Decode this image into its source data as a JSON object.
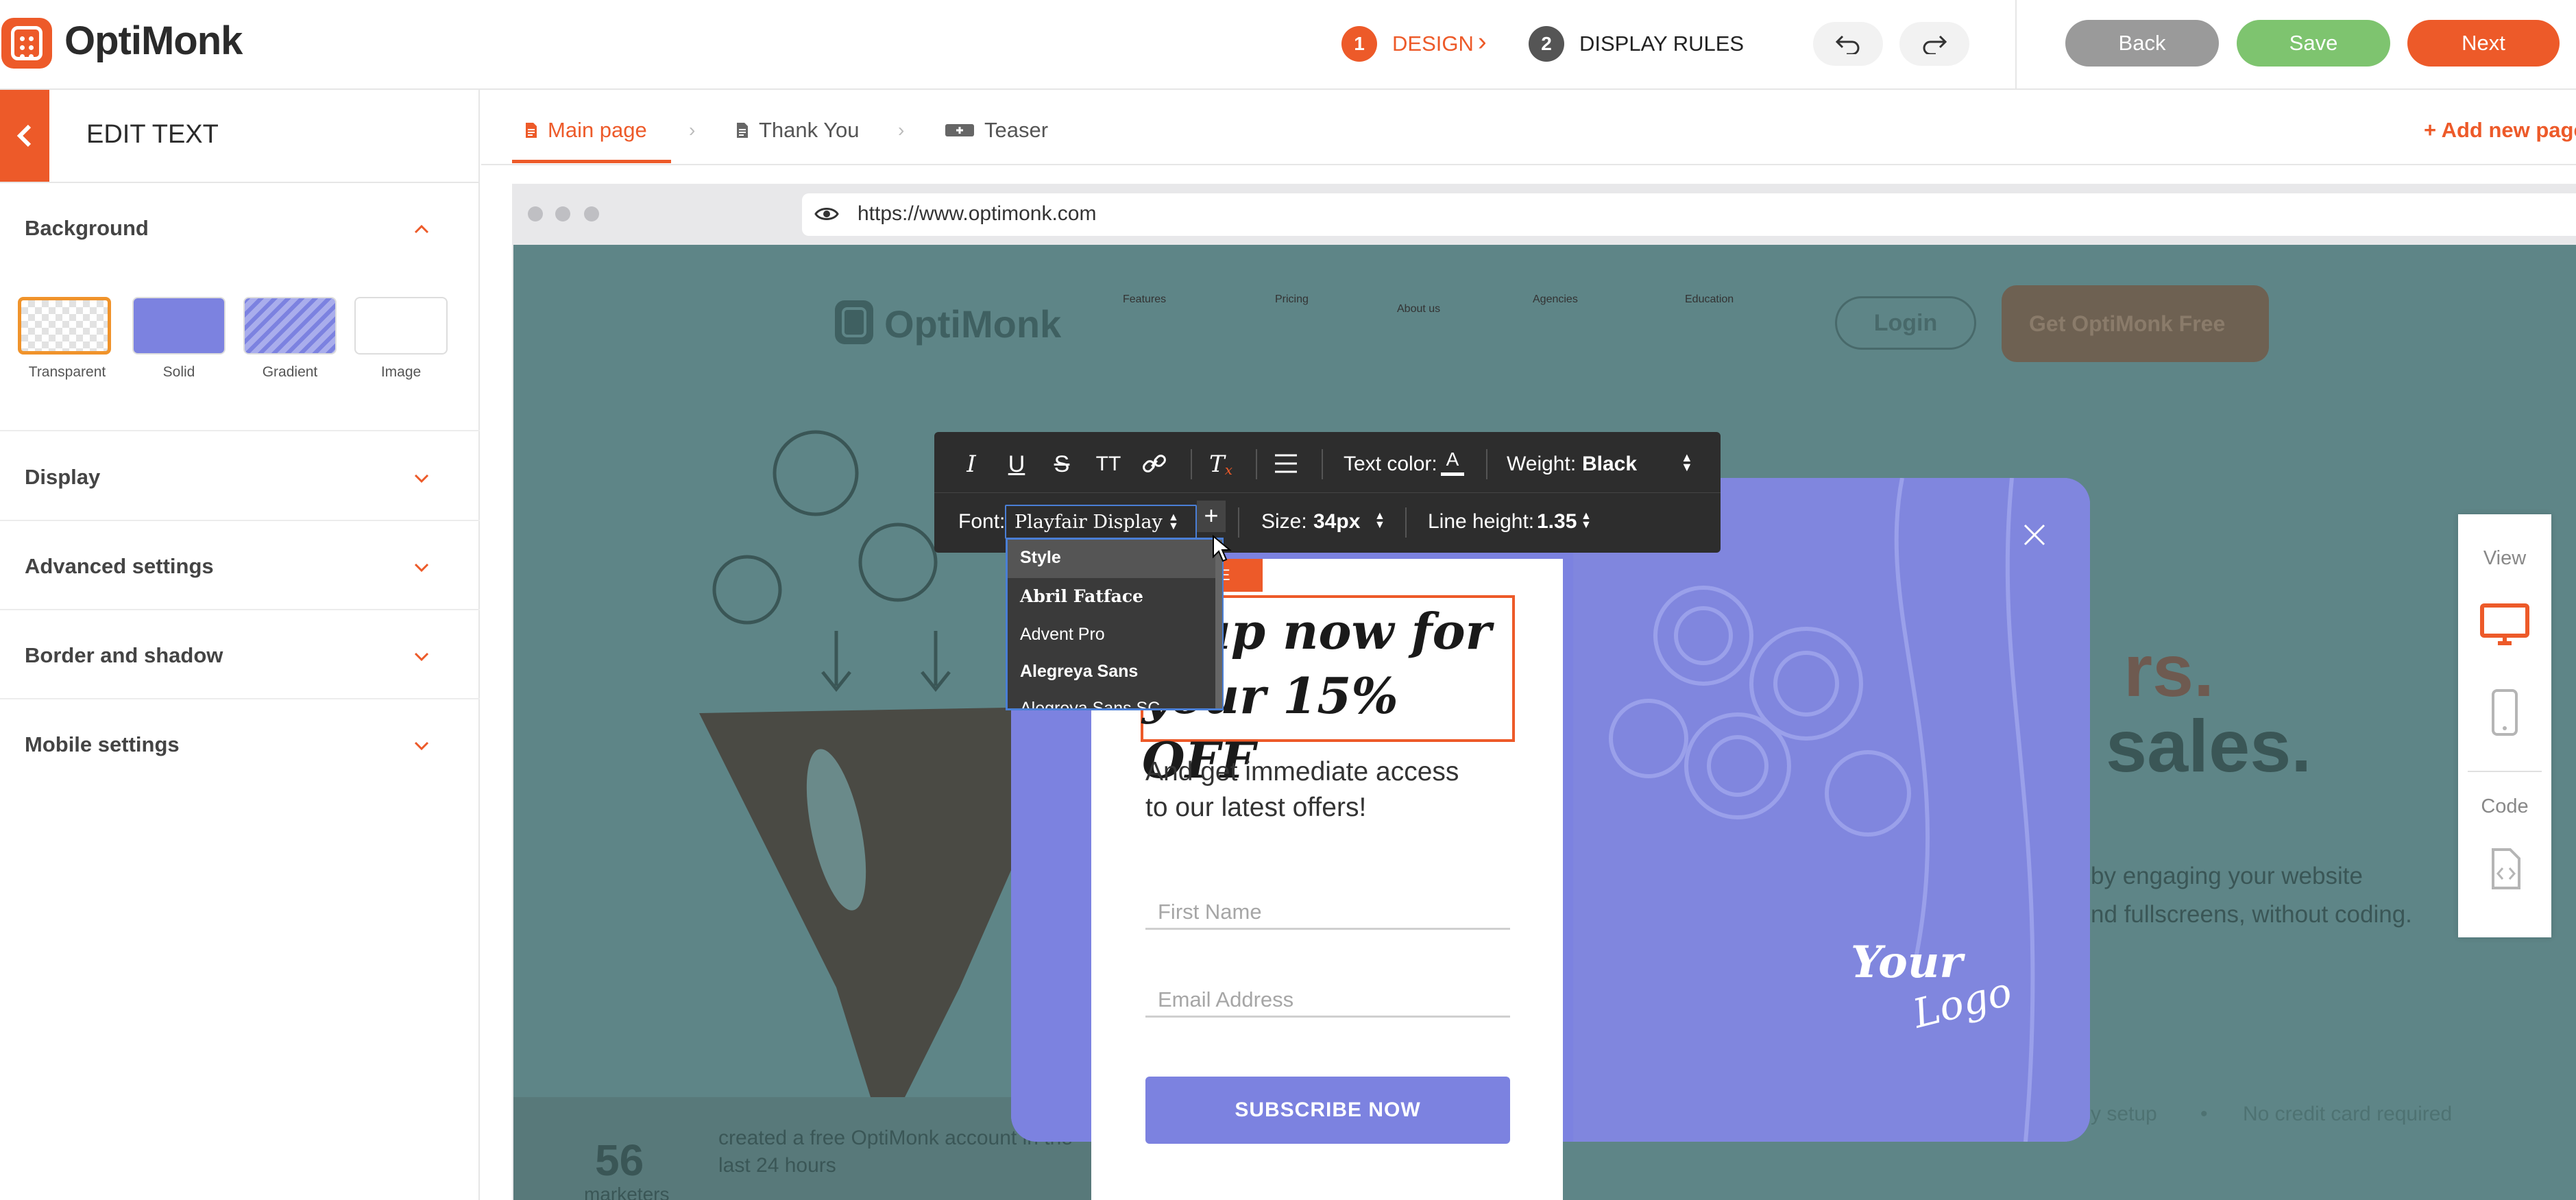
{
  "app": {
    "logo_text": "OptiMonk",
    "accent_color": "#ed5a29"
  },
  "header": {
    "steps": [
      {
        "num": "1",
        "label": "DESIGN",
        "active": true
      },
      {
        "num": "2",
        "label": "DISPLAY RULES",
        "active": false
      }
    ],
    "undo_icon": "undo-icon",
    "redo_icon": "redo-icon",
    "back_label": "Back",
    "save_label": "Save",
    "next_label": "Next"
  },
  "sidebar": {
    "title": "EDIT TEXT",
    "background": {
      "title": "Background",
      "options": [
        {
          "label": "Transparent",
          "selected": true
        },
        {
          "label": "Solid",
          "selected": false
        },
        {
          "label": "Gradient",
          "selected": false
        },
        {
          "label": "Image",
          "selected": false
        }
      ]
    },
    "sections": [
      "Display",
      "Advanced settings",
      "Border and shadow",
      "Mobile settings"
    ]
  },
  "pages": {
    "tabs": [
      {
        "label": "Main page",
        "active": true,
        "icon": "page-icon"
      },
      {
        "label": "Thank You",
        "active": false,
        "icon": "page-icon"
      },
      {
        "label": "Teaser",
        "active": false,
        "icon": "teaser-icon"
      }
    ],
    "add_label": "+ Add new page"
  },
  "browser": {
    "url": "https://www.optimonk.com"
  },
  "site": {
    "logo_text": "OptiMonk",
    "nav": [
      "Features",
      "Pricing",
      "About us",
      "Agencies",
      "Education"
    ],
    "login": "Login",
    "cta": "Get OptiMonk Free",
    "headline_tail": [
      "rs.",
      "sales."
    ],
    "body_tail": [
      "by engaging your website",
      "nd fullscreens, without coding."
    ],
    "stat_number": "56",
    "stat_sub": "marketers",
    "stat_text": "created a free OptiMonk account in the last 24 hours",
    "footnote_1": "y setup",
    "footnote_2": "No credit card required"
  },
  "popup": {
    "element_tag": "DE",
    "headline": "n up now for\nyour 15% OFF",
    "subtext": "And get immediate access\nto our latest offers!",
    "first_name_placeholder": "First Name",
    "email_placeholder": "Email Address",
    "subscribe_label": "SUBSCRIBE NOW",
    "logo_line1": "Your",
    "logo_line2": "Logo"
  },
  "toolbar": {
    "text_color_label": "Text color:",
    "weight_label": "Weight:",
    "weight_value": "Black",
    "font_label": "Font:",
    "font_value": "Playfair Display",
    "size_label": "Size:",
    "size_value": "34px",
    "line_height_label": "Line height:",
    "line_height_value": "1.35"
  },
  "font_dropdown": {
    "options": [
      "Style",
      "Abril Fatface",
      "Advent Pro",
      "Alegreya Sans",
      "Alegreya Sans SC"
    ]
  },
  "viewpanel": {
    "view_label": "View",
    "code_label": "Code"
  }
}
